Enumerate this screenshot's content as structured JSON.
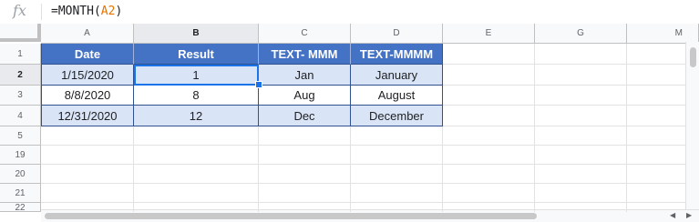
{
  "formula_bar": {
    "fx": "fx",
    "prefix": "=MONTH(",
    "ref": "A2",
    "suffix": ")"
  },
  "columns": [
    "A",
    "B",
    "C",
    "D",
    "E",
    "G",
    "M"
  ],
  "rows": [
    "1",
    "2",
    "3",
    "4",
    "5",
    "19",
    "20",
    "21",
    "22"
  ],
  "table": {
    "headers": [
      "Date",
      "Result",
      "TEXT- MMM",
      "TEXT-MMMM"
    ],
    "data": [
      [
        "1/15/2020",
        "1",
        "Jan",
        "January"
      ],
      [
        "8/8/2020",
        "8",
        "Aug",
        "August"
      ],
      [
        "12/31/2020",
        "12",
        "Dec",
        "December"
      ]
    ]
  },
  "colors": {
    "header_fill": "#4472c4",
    "band_fill": "#d9e5f6",
    "selection": "#1a73e8"
  }
}
